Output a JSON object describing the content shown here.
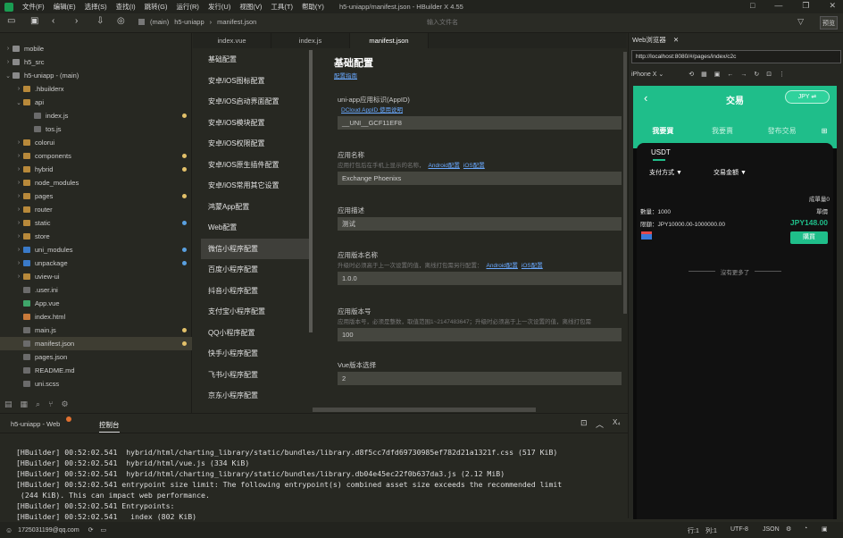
{
  "window": {
    "menu": [
      "文件(F)",
      "编辑(E)",
      "选择(S)",
      "查找(I)",
      "跳转(G)",
      "运行(R)",
      "发行(U)",
      "视图(V)",
      "工具(T)",
      "帮助(Y)"
    ],
    "title": "h5-uniapp/manifest.json - HBuilder X 4.55",
    "controls": [
      "□",
      "—",
      "❐",
      "✕"
    ]
  },
  "toolbar": {
    "breadcrumb": [
      "(main)",
      "h5-uniapp",
      "manifest.json"
    ],
    "file_search_placeholder": "输入文件名",
    "preview_label": "预览"
  },
  "sidebar": {
    "items": [
      {
        "label": "mobile",
        "arrow": "›",
        "color": "#8a8a8a",
        "dot": ""
      },
      {
        "label": "h5_src",
        "arrow": "›",
        "color": "#8a8a8a",
        "dot": ""
      },
      {
        "label": "h5-uniapp - (main)",
        "arrow": "⌄",
        "color": "#8a8a8a",
        "dot": ""
      },
      {
        "label": ".hbuilderx",
        "arrow": "›",
        "color": "#b8893a",
        "dot": ""
      },
      {
        "label": "api",
        "arrow": "⌄",
        "color": "#b8893a",
        "dot": ""
      },
      {
        "label": "index.js",
        "arrow": "",
        "color": "#6b6b6b",
        "dot": "#e3c16a"
      },
      {
        "label": "tos.js",
        "arrow": "",
        "color": "#6b6b6b",
        "dot": ""
      },
      {
        "label": "colorui",
        "arrow": "›",
        "color": "#b8893a",
        "dot": ""
      },
      {
        "label": "components",
        "arrow": "›",
        "color": "#b8893a",
        "dot": "#e3c16a"
      },
      {
        "label": "hybrid",
        "arrow": "›",
        "color": "#b8893a",
        "dot": "#e3c16a"
      },
      {
        "label": "node_modules",
        "arrow": "›",
        "color": "#b8893a",
        "dot": ""
      },
      {
        "label": "pages",
        "arrow": "›",
        "color": "#b8893a",
        "dot": "#e3c16a"
      },
      {
        "label": "router",
        "arrow": "›",
        "color": "#b8893a",
        "dot": ""
      },
      {
        "label": "static",
        "arrow": "›",
        "color": "#b8893a",
        "dot": "#5aa0e0"
      },
      {
        "label": "store",
        "arrow": "›",
        "color": "#b8893a",
        "dot": ""
      },
      {
        "label": "uni_modules",
        "arrow": "›",
        "color": "#3a7ac8",
        "dot": "#5aa0e0"
      },
      {
        "label": "unpackage",
        "arrow": "›",
        "color": "#3a7ac8",
        "dot": "#5aa0e0"
      },
      {
        "label": "uview-ui",
        "arrow": "›",
        "color": "#b8893a",
        "dot": ""
      },
      {
        "label": ".user.ini",
        "arrow": "",
        "color": "#6b6b6b",
        "dot": ""
      },
      {
        "label": "App.vue",
        "arrow": "",
        "color": "#3fa66a",
        "dot": ""
      },
      {
        "label": "index.html",
        "arrow": "",
        "color": "#c97a3a",
        "dot": ""
      },
      {
        "label": "main.js",
        "arrow": "",
        "color": "#6b6b6b",
        "dot": "#e3c16a"
      },
      {
        "label": "manifest.json",
        "arrow": "",
        "color": "#6b6b6b",
        "dot": "#e3c16a"
      },
      {
        "label": "pages.json",
        "arrow": "",
        "color": "#6b6b6b",
        "dot": ""
      },
      {
        "label": "README.md",
        "arrow": "",
        "color": "#6b6b6b",
        "dot": ""
      },
      {
        "label": "uni.scss",
        "arrow": "",
        "color": "#6b6b6b",
        "dot": ""
      }
    ]
  },
  "editor_tabs": [
    "index.vue",
    "index.js",
    "manifest.json"
  ],
  "settings_nav": [
    "基础配置",
    "安卓/iOS图标配置",
    "安卓/iOS启动界面配置",
    "安卓/iOS模块配置",
    "安卓/iOS权限配置",
    "安卓/iOS原生插件配置",
    "安卓/iOS常用其它设置",
    "鸿蒙App配置",
    "Web配置",
    "微信小程序配置",
    "百度小程序配置",
    "抖音小程序配置",
    "支付宝小程序配置",
    "QQ小程序配置",
    "快手小程序配置",
    "飞书小程序配置",
    "京东小程序配置"
  ],
  "form": {
    "heading": "基础配置",
    "heading_link": "配置指南",
    "fields": [
      {
        "label": "uni-app应用标识(AppID)",
        "hint": "",
        "hint_links": [
          "DCloud AppID 使用说明"
        ],
        "value": "__UNI__GCF11EF8"
      },
      {
        "label": "应用名称",
        "hint": "应用打包后在手机上显示的名称，",
        "hint_links": [
          "Android配置",
          "iOS配置"
        ],
        "value": "Exchange Phoenixs"
      },
      {
        "label": "应用描述",
        "hint": "",
        "hint_links": [],
        "value": "测试"
      },
      {
        "label": "应用版本名称",
        "hint": "升级时必须高于上一次设置的值，离线打包需另行配置：",
        "hint_links": [
          "Android配置",
          "iOS配置"
        ],
        "value": "1.0.0"
      },
      {
        "label": "应用版本号",
        "hint": "应用版本号，必须是整数，取值范围1~2147483647；升级时必须高于上一次设置的值，离线打包需",
        "hint_links": [],
        "value": "100"
      },
      {
        "label": "Vue版本选择",
        "hint": "",
        "hint_links": [],
        "value": "2"
      }
    ]
  },
  "browser": {
    "tab_label": "Web浏览器",
    "url": "http://localhost:8080/#/pages/index/c2c",
    "device": "iPhone X",
    "phone": {
      "title": "交易",
      "currency_btn": "JPY ⇌",
      "tabs": [
        "我要買",
        "我要賣",
        "發布交易"
      ],
      "coin": "USDT",
      "filter1": "支付方式 ▼",
      "filter2": "交易金額 ▼",
      "deals": "成單量0",
      "price_label": "單價",
      "qty": "數量：1000",
      "limit": "限額：JPY10000.00-1000000.00",
      "price": "JPY148.00",
      "buy_btn": "購買",
      "no_more": "沒有更多了"
    }
  },
  "panel": {
    "tabs": [
      "h5-uniapp - Web",
      "控制台"
    ],
    "lines": [
      "[HBuilder] 00:52:02.541  hybrid/html/charting_library/static/bundles/library.d8f5cc7dfd69730985ef782d21a1321f.css (517 KiB)",
      "[HBuilder] 00:52:02.541  hybrid/html/vue.js (334 KiB)",
      "[HBuilder] 00:52:02.541  hybrid/html/charting_library/static/bundles/library.db04e45ec22f0b637da3.js (2.12 MiB)",
      "[HBuilder] 00:52:02.541 entrypoint size limit: The following entrypoint(s) combined asset size exceeds the recommended limit",
      " (244 KiB). This can impact web performance.",
      "[HBuilder] 00:52:02.541 Entrypoints:",
      "[HBuilder] 00:52:02.541   index (802 KiB)"
    ]
  },
  "status": {
    "user": "1725031199@qq.com",
    "line": "行:1",
    "col": "列:1",
    "encoding": "UTF-8",
    "lang": "JSON"
  }
}
